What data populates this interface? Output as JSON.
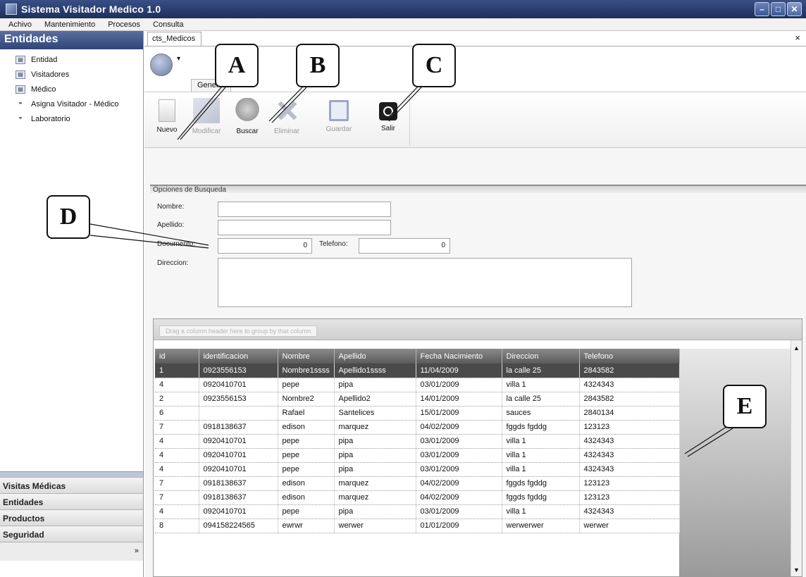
{
  "window": {
    "title": "Sistema Visitador Medico 1.0",
    "min": "–",
    "max": "□",
    "close": "✕"
  },
  "menu": [
    "Achivo",
    "Mantenimiento",
    "Procesos",
    "Consulta"
  ],
  "sidebar": {
    "header": "Entidades",
    "items": [
      "Entidad",
      "Visitadores",
      "Médico",
      "Asigna Visitador - Médico",
      "Laboratorio"
    ],
    "sections": [
      "Visitas Médicas",
      "Entidades",
      "Productos",
      "Seguridad"
    ],
    "footer_chevron": "»"
  },
  "tab": {
    "label": "cts_Medicos",
    "close": "×"
  },
  "ribbon": {
    "qat": "▾",
    "tab": "General",
    "buttons": {
      "nuevo": "Nuevo",
      "modificar": "Modificar",
      "buscar": "Buscar",
      "eliminar": "Eliminar",
      "guardar": "Guardar",
      "salir": "Salir"
    }
  },
  "search": {
    "header": "Opciones de Busqueda",
    "nombre_label": "Nombre:",
    "apellido_label": "Apellido:",
    "documento_label": "Documento:",
    "documento_value": "0",
    "telefono_label": "Telefono:",
    "telefono_value": "0",
    "direccion_label": "Direccion:"
  },
  "grid": {
    "group_hint": "Drag a column header here to group by that column",
    "columns": [
      "id",
      "identificacion",
      "Nombre",
      "Apellido",
      "Fecha Nacimiento",
      "Direccion",
      "Telefono"
    ],
    "rows": [
      [
        "1",
        "0923556153",
        "Nombre1ssss",
        "Apellido1ssss",
        "11/04/2009",
        "la calle 25",
        "2843582"
      ],
      [
        "4",
        "0920410701",
        "pepe",
        "pipa",
        "03/01/2009",
        "villa 1",
        "4324343"
      ],
      [
        "2",
        "0923556153",
        "Nombre2",
        "Apellido2",
        "14/01/2009",
        "la calle 25",
        "2843582"
      ],
      [
        "6",
        "",
        "Rafael",
        "Santelices",
        "15/01/2009",
        "sauces",
        "2840134"
      ],
      [
        "7",
        "0918138637",
        "edison",
        "marquez",
        "04/02/2009",
        "fggds fgddg",
        "123123"
      ],
      [
        "4",
        "0920410701",
        "pepe",
        "pipa",
        "03/01/2009",
        "villa 1",
        "4324343"
      ],
      [
        "4",
        "0920410701",
        "pepe",
        "pipa",
        "03/01/2009",
        "villa 1",
        "4324343"
      ],
      [
        "4",
        "0920410701",
        "pepe",
        "pipa",
        "03/01/2009",
        "villa 1",
        "4324343"
      ],
      [
        "7",
        "0918138637",
        "edison",
        "marquez",
        "04/02/2009",
        "fggds fgddg",
        "123123"
      ],
      [
        "7",
        "0918138637",
        "edison",
        "marquez",
        "04/02/2009",
        "fggds fgddg",
        "123123"
      ],
      [
        "4",
        "0920410701",
        "pepe",
        "pipa",
        "03/01/2009",
        "villa 1",
        "4324343"
      ],
      [
        "8",
        "094158224565",
        "ewrwr",
        "werwer",
        "01/01/2009",
        "werwerwer",
        "werwer"
      ]
    ],
    "selected_row": 0
  },
  "callouts": [
    "A",
    "B",
    "C",
    "D",
    "E"
  ]
}
